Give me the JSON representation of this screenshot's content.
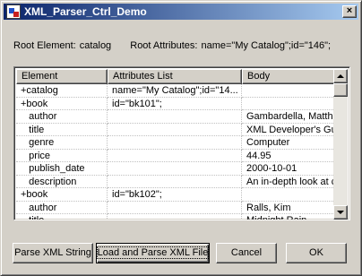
{
  "window": {
    "title": "XML_Parser_Ctrl_Demo",
    "close_glyph": "×",
    "app_icon": "app-icon"
  },
  "root": {
    "element_label": "Root Element:",
    "element_value": "catalog",
    "attributes_label": "Root Attributes:",
    "attributes_value": "name=\"My Catalog\";id=\"146\";"
  },
  "list": {
    "columns": [
      "Element",
      "Attributes List",
      "Body"
    ],
    "rows": [
      [
        "+catalog",
        "name=\"My Catalog\";id=\"14...",
        ""
      ],
      [
        "+book",
        "id=\"bk101\";",
        ""
      ],
      [
        "   author",
        "",
        "Gambardella, Matthew"
      ],
      [
        "   title",
        "",
        "XML Developer's Gu..."
      ],
      [
        "   genre",
        "",
        "Computer"
      ],
      [
        "   price",
        "",
        "44.95"
      ],
      [
        "   publish_date",
        "",
        "2000-10-01"
      ],
      [
        "   description",
        "",
        "An in-depth look at c..."
      ],
      [
        "+book",
        "id=\"bk102\";",
        ""
      ],
      [
        "   author",
        "",
        "Ralls, Kim"
      ],
      [
        "   title",
        "",
        "Midnight Rain"
      ]
    ]
  },
  "buttons": {
    "parse_string": "Parse XML String",
    "load_parse_file": "Load and Parse XML File",
    "cancel": "Cancel",
    "ok": "OK"
  }
}
